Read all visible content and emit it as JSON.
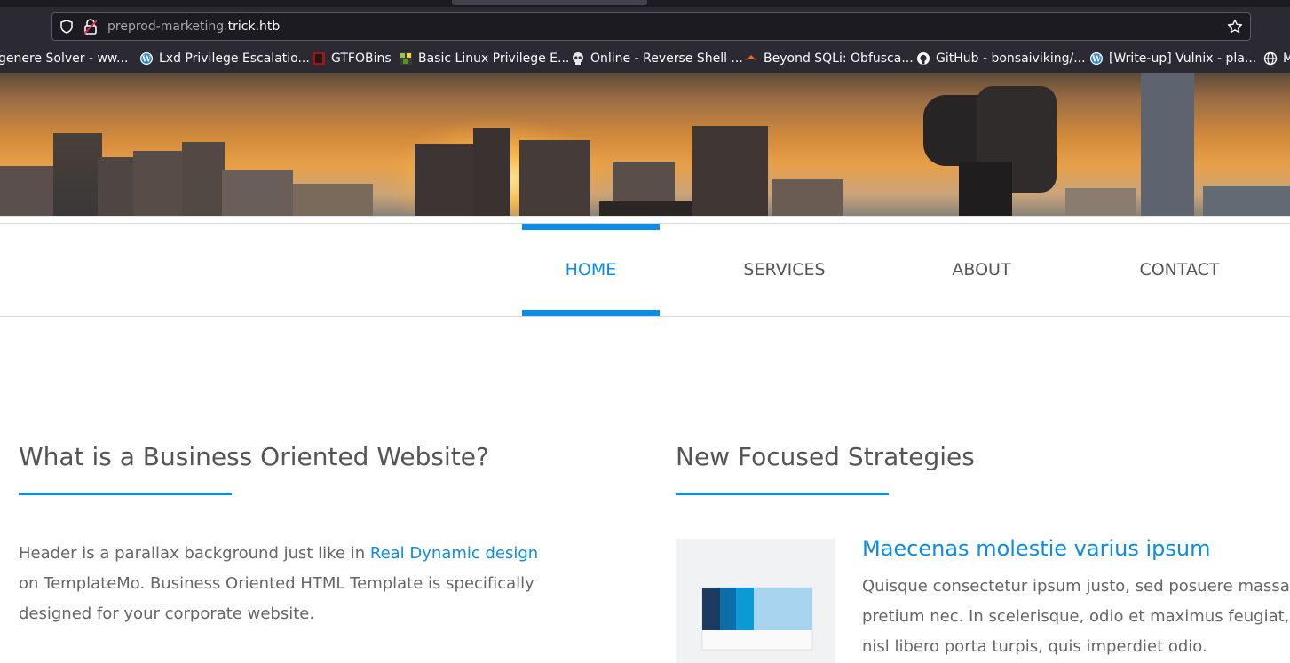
{
  "browser": {
    "url_prefix": "preprod-marketing.",
    "url_host": "trick.htb",
    "bookmarks": [
      {
        "label": "genere Solver - ww...",
        "icon": "generic-icon"
      },
      {
        "label": "Lxd Privilege Escalatio...",
        "icon": "wordpress-icon"
      },
      {
        "label": "GTFOBins",
        "icon": "gtfobins-icon"
      },
      {
        "label": "Basic Linux Privilege E...",
        "icon": "linux-icon"
      },
      {
        "label": "Online - Reverse Shell ...",
        "icon": "skull-icon"
      },
      {
        "label": "Beyond SQLi: Obfusca...",
        "icon": "burp-icon"
      },
      {
        "label": "GitHub - bonsaiviking/...",
        "icon": "github-icon"
      },
      {
        "label": "[Write-up] Vulnix - pla...",
        "icon": "wordpress-icon"
      },
      {
        "label": "M",
        "icon": "globe-icon"
      }
    ]
  },
  "nav": {
    "items": [
      {
        "label": "HOME",
        "active": true
      },
      {
        "label": "SERVICES",
        "active": false
      },
      {
        "label": "ABOUT",
        "active": false
      },
      {
        "label": "CONTACT",
        "active": false
      }
    ]
  },
  "left": {
    "title": "What is a Business Oriented Website?",
    "para_before_link": "Header is a parallax background just like in ",
    "link_text": "Real Dynamic design",
    "para_after_link": " on TemplateMo. Business Oriented HTML Template is specifically designed for your corporate website."
  },
  "right": {
    "title": "New Focused Strategies",
    "item_title": "Maecenas molestie varius ipsum",
    "item_text": "Quisque consectetur ipsum justo, sed posuere massa pretium nec. In scelerisque, odio et maximus feugiat, nisl libero porta turpis, quis imperdiet odio."
  },
  "colors": {
    "accent": "#0b8ce6",
    "browser_bg": "#2b2a33"
  }
}
